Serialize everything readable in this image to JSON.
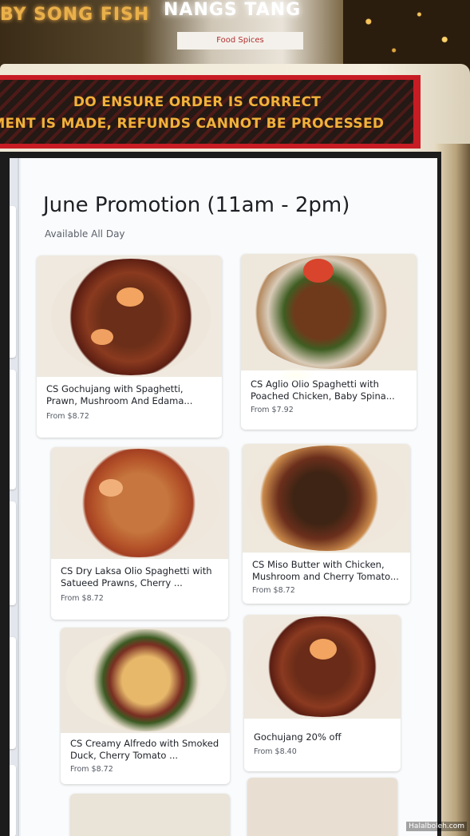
{
  "environment": {
    "sign_left": "BY SONG FISH",
    "sign_center": "NANGS TANG",
    "store_sign": "Food Spices"
  },
  "banner": {
    "line1": "DO ENSURE ORDER IS CORRECT",
    "line2": "YMENT IS MADE, REFUNDS CANNOT BE PROCESSED"
  },
  "menu": {
    "title": "June Promotion (11am - 2pm)",
    "subtitle": "Available All Day",
    "items": [
      {
        "name": "CS Gochujang with Spaghetti, Prawn, Mushroom And Edama...",
        "price": "From $8.72"
      },
      {
        "name": "CS Aglio Olio Spaghetti with Poached Chicken, Baby Spina...",
        "price": "From $7.92"
      },
      {
        "name": "CS Dry Laksa Olio Spaghetti with Satueed Prawns, Cherry ...",
        "price": "From $8.72"
      },
      {
        "name": "CS Miso Butter with Chicken, Mushroom and Cherry Tomato...",
        "price": "From $8.72"
      },
      {
        "name": "CS Creamy Alfredo with Smoked Duck, Cherry Tomato ...",
        "price": "From $8.72"
      },
      {
        "name": "Gochujang 20% off",
        "price": "From $8.40"
      }
    ]
  },
  "watermark": "Halalboleh.com",
  "colors": {
    "banner_red": "#c81c24",
    "banner_text": "#f2b23a",
    "panel_bg": "#fafbfc"
  }
}
